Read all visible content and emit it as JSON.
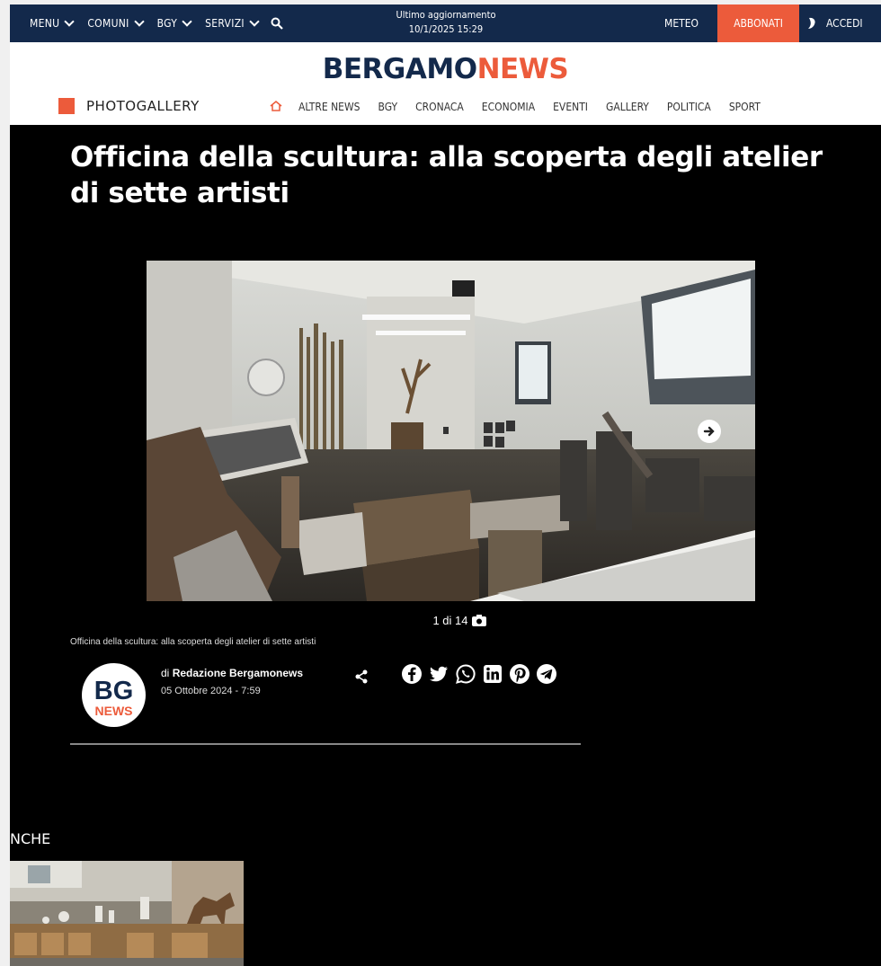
{
  "topbar": {
    "menu": "MENU",
    "comuni": "COMUNI",
    "bgy": "BGY",
    "servizi": "SERVIZI",
    "update_label": "Ultimo aggiornamento",
    "update_time": "10/1/2025 15:29",
    "meteo": "METEO",
    "abbonati": "ABBONATI",
    "accedi": "ACCEDI"
  },
  "logo": {
    "part1": "BERGAMO",
    "part2": "NEWS"
  },
  "section": "PHOTOGALLERY",
  "nav": [
    "ALTRE NEWS",
    "BGY",
    "CRONACA",
    "ECONOMIA",
    "EVENTI",
    "GALLERY",
    "POLITICA",
    "SPORT"
  ],
  "article": {
    "title": "Officina della scultura: alla scoperta degli atelier di sette artisti",
    "counter": "1 di 14",
    "caption": "Officina della scultura: alla scoperta degli atelier di sette artisti",
    "author_prefix": "di",
    "author": "Redazione Bergamonews",
    "date": "05 Ottobre 2024 - 7:59",
    "avatar_text1": "BG",
    "avatar_text2": "NEWS"
  },
  "related": {
    "heading": "NCHE"
  },
  "colors": {
    "navy": "#13294b",
    "accent": "#ec5b3b"
  },
  "icons": [
    "search-icon",
    "user-icon",
    "home-icon",
    "arrow-right-icon",
    "camera-icon",
    "share-icon",
    "facebook-icon",
    "twitter-icon",
    "whatsapp-icon",
    "linkedin-icon",
    "pinterest-icon",
    "telegram-icon"
  ]
}
